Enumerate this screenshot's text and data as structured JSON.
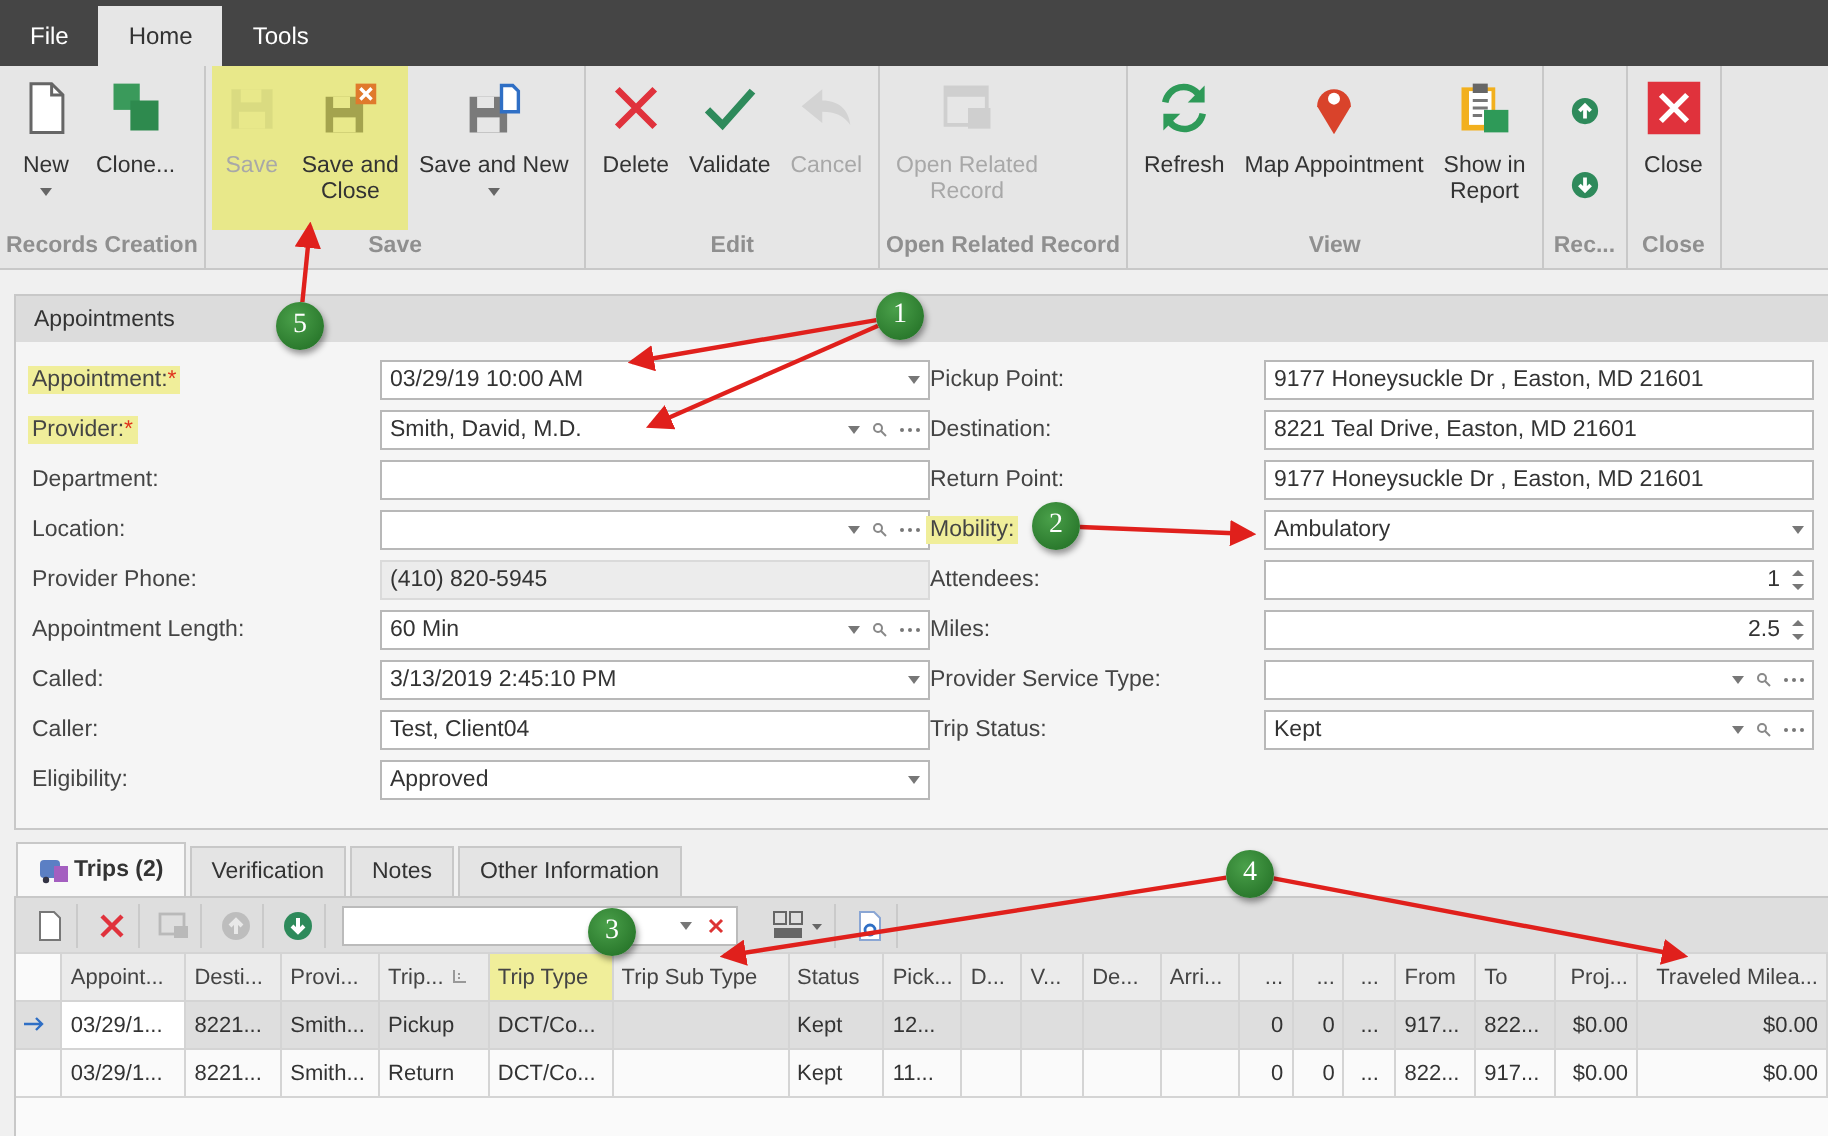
{
  "menu_tabs": [
    {
      "label": "File",
      "selected": false
    },
    {
      "label": "Home",
      "selected": true
    },
    {
      "label": "Tools",
      "selected": false
    }
  ],
  "ribbon": [
    {
      "label": "Records Creation",
      "buttons": [
        {
          "kind": "large",
          "label": "New",
          "disabled": false,
          "highlighted": false,
          "dropdown": true
        },
        {
          "kind": "large",
          "label": "Clone...",
          "disabled": false,
          "highlighted": false,
          "dropdown": false
        }
      ]
    },
    {
      "label": "Save",
      "buttons": [
        {
          "kind": "large",
          "label": "Save",
          "disabled": true,
          "highlighted": true,
          "dropdown": false
        },
        {
          "kind": "large",
          "label": "Save and\nClose",
          "disabled": false,
          "highlighted": true,
          "dropdown": false
        },
        {
          "kind": "large",
          "label": "Save and New",
          "disabled": false,
          "highlighted": false,
          "dropdown": true
        }
      ]
    },
    {
      "label": "Edit",
      "buttons": [
        {
          "kind": "large",
          "label": "Delete",
          "disabled": false,
          "highlighted": false,
          "dropdown": false
        },
        {
          "kind": "large",
          "label": "Validate",
          "disabled": false,
          "highlighted": false,
          "dropdown": false
        },
        {
          "kind": "large",
          "label": "Cancel",
          "disabled": true,
          "highlighted": false,
          "dropdown": false
        }
      ]
    },
    {
      "label": "Open Related Record",
      "buttons": [
        {
          "kind": "large",
          "label": "Open Related\nRecord",
          "disabled": true,
          "highlighted": false,
          "dropdown": false
        }
      ]
    },
    {
      "label": "View",
      "buttons": [
        {
          "kind": "large",
          "label": "Refresh",
          "disabled": false,
          "highlighted": false,
          "dropdown": false
        },
        {
          "kind": "large",
          "label": "Map Appointment",
          "disabled": false,
          "highlighted": false,
          "dropdown": false
        },
        {
          "kind": "large",
          "label": "Show in\nReport",
          "disabled": false,
          "highlighted": false,
          "dropdown": false
        }
      ]
    },
    {
      "label": "Rec...",
      "buttons": [
        {
          "kind": "small",
          "disabled": false,
          "highlighted": false
        },
        {
          "kind": "small",
          "disabled": false,
          "highlighted": false
        }
      ]
    },
    {
      "label": "Close",
      "buttons": [
        {
          "kind": "large",
          "label": "Close",
          "disabled": false,
          "highlighted": false,
          "dropdown": false
        }
      ]
    }
  ],
  "panel_title": "Appointments",
  "left_fields": [
    {
      "label": "Appointment:",
      "required_mark": "*",
      "highlighted": true,
      "kind": "combo",
      "value": "03/29/19 10:00 AM"
    },
    {
      "label": "Provider:",
      "required_mark": "*",
      "highlighted": true,
      "kind": "lookup",
      "value": "Smith, David, M.D."
    },
    {
      "label": "Department:",
      "highlighted": false,
      "kind": "text"
    },
    {
      "label": "Location:",
      "highlighted": false,
      "kind": "lookup"
    },
    {
      "label": "Provider Phone:",
      "highlighted": false,
      "kind": "readonly",
      "value": "(410) 820-5945"
    },
    {
      "label": "Appointment Length:",
      "highlighted": false,
      "kind": "lookup",
      "value": "60 Min"
    },
    {
      "label": "Called:",
      "highlighted": false,
      "kind": "combo",
      "value": "3/13/2019 2:45:10 PM"
    },
    {
      "label": "Caller:",
      "highlighted": false,
      "kind": "text",
      "value": "Test, Client04"
    },
    {
      "label": "Eligibility:",
      "highlighted": false,
      "kind": "combo",
      "value": "Approved"
    }
  ],
  "right_fields": [
    {
      "label": "Pickup Point:",
      "highlighted": false,
      "kind": "text",
      "value": "9177 Honeysuckle Dr , Easton, MD 21601"
    },
    {
      "label": "Destination:",
      "highlighted": false,
      "kind": "text",
      "value": "8221 Teal Drive, Easton, MD 21601"
    },
    {
      "label": "Return Point:",
      "highlighted": false,
      "kind": "text",
      "value": "9177 Honeysuckle Dr , Easton, MD 21601"
    },
    {
      "label": "Mobility:",
      "highlighted": true,
      "kind": "combo",
      "value": "Ambulatory"
    },
    {
      "label": "Attendees:",
      "highlighted": false,
      "kind": "spin",
      "value": "1"
    },
    {
      "label": "Miles:",
      "highlighted": false,
      "kind": "spin",
      "value": "2.5"
    },
    {
      "label": "Provider Service Type:",
      "highlighted": false,
      "kind": "lookup"
    },
    {
      "label": "Trip Status:",
      "highlighted": false,
      "kind": "lookup",
      "value": "Kept"
    }
  ],
  "detail_tabs": [
    {
      "label": "Trips (2)",
      "selected": true,
      "has_icon": true
    },
    {
      "label": "Verification",
      "selected": false,
      "has_icon": false
    },
    {
      "label": "Notes",
      "selected": false,
      "has_icon": false
    },
    {
      "label": "Other Information",
      "selected": false,
      "has_icon": false
    }
  ],
  "grid_toolbar": [
    {
      "kind": "new",
      "disabled": false
    },
    {
      "kind": "delete",
      "disabled": false
    },
    {
      "kind": "window",
      "disabled": true
    },
    {
      "kind": "up",
      "disabled": true
    },
    {
      "kind": "down",
      "disabled": false
    },
    {
      "kind": "search"
    },
    {
      "kind": "layout",
      "disabled": false
    },
    {
      "kind": "preview",
      "disabled": false
    }
  ],
  "grid": {
    "columns": [
      {
        "label": "Appoint...",
        "highlighted": false,
        "sorted": false
      },
      {
        "label": "Desti...",
        "highlighted": false,
        "sorted": false
      },
      {
        "label": "Provi...",
        "highlighted": false,
        "sorted": false
      },
      {
        "label": "Trip...",
        "highlighted": false,
        "sorted": true
      },
      {
        "label": "Trip Type",
        "highlighted": true,
        "sorted": false
      },
      {
        "label": "Trip Sub Type",
        "highlighted": false,
        "sorted": false
      },
      {
        "label": "Status",
        "highlighted": false,
        "sorted": false
      },
      {
        "label": "Pick...",
        "highlighted": false,
        "sorted": false
      },
      {
        "label": "D...",
        "highlighted": false,
        "sorted": false
      },
      {
        "label": "V...",
        "highlighted": false,
        "sorted": false
      },
      {
        "label": "De...",
        "highlighted": false,
        "sorted": false
      },
      {
        "label": "Arri...",
        "highlighted": false,
        "sorted": false
      },
      {
        "label": "...",
        "highlighted": false,
        "sorted": false
      },
      {
        "label": "...",
        "highlighted": false,
        "sorted": false
      },
      {
        "label": "...",
        "highlighted": false,
        "sorted": false
      },
      {
        "label": "From",
        "highlighted": false,
        "sorted": false
      },
      {
        "label": "To",
        "highlighted": false,
        "sorted": false
      },
      {
        "label": "Proj...",
        "highlighted": false,
        "sorted": false
      },
      {
        "label": "Traveled Milea...",
        "highlighted": false,
        "sorted": false
      }
    ],
    "rows": [
      {
        "selected": true,
        "cells": [
          "03/29/1...",
          "8221...",
          "Smith...",
          "Pickup",
          "DCT/Co...",
          null,
          "Kept",
          "12...",
          null,
          null,
          null,
          null,
          "0",
          "0",
          "...",
          "917...",
          "822...",
          "$0.00",
          "$0.00"
        ]
      },
      {
        "selected": false,
        "cells": [
          "03/29/1...",
          "8221...",
          "Smith...",
          "Return",
          "DCT/Co...",
          null,
          "Kept",
          "11...",
          null,
          null,
          null,
          null,
          "0",
          "0",
          "...",
          "822...",
          "917...",
          "$0.00",
          "$0.00"
        ]
      }
    ]
  },
  "callouts": [
    {
      "number": "1"
    },
    {
      "number": "2"
    },
    {
      "number": "3"
    },
    {
      "number": "4"
    },
    {
      "number": "5"
    }
  ]
}
